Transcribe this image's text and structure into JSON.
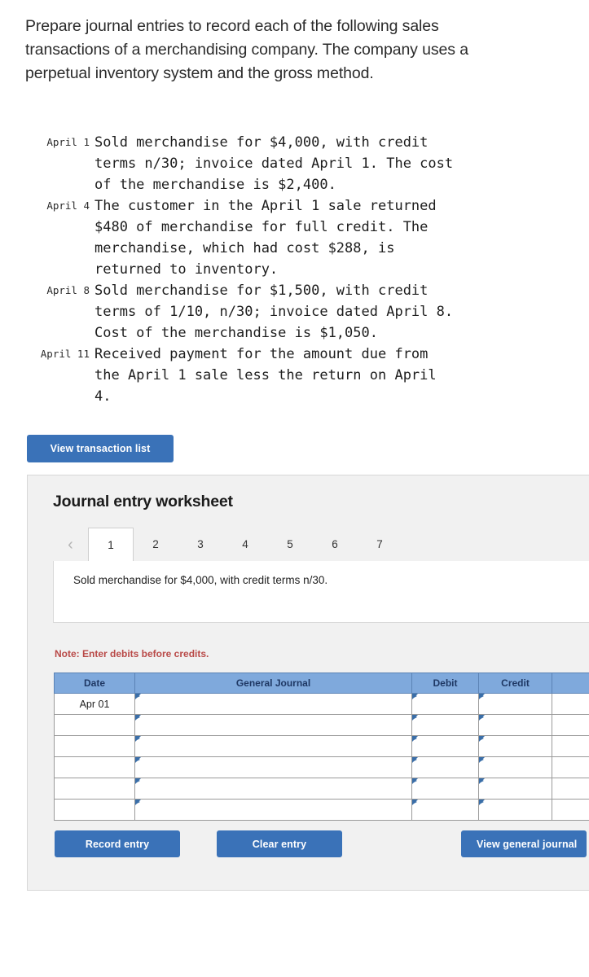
{
  "intro": {
    "text": "Prepare journal entries to record each of the following sales transactions of a merchandising company. The company uses a perpetual inventory system and the gross method."
  },
  "transactions": [
    {
      "date": "April 1",
      "text": "Sold merchandise for $4,000, with credit\nterms n/30; invoice dated April 1. The cost\nof the merchandise is $2,400."
    },
    {
      "date": "April 4",
      "text": "The customer in the April 1 sale returned\n$480 of merchandise for full credit. The\nmerchandise, which had cost $288, is\nreturned to inventory."
    },
    {
      "date": "April 8",
      "text": "Sold merchandise for $1,500, with credit\nterms of 1/10, n/30; invoice dated April 8.\nCost of the merchandise is $1,050."
    },
    {
      "date": "April 11",
      "text": "Received payment for the amount due from\nthe April 1 sale less the return on April\n4."
    }
  ],
  "buttons": {
    "view_transaction_list": "View transaction list",
    "record_entry": "Record entry",
    "clear_entry": "Clear entry",
    "view_general_journal": "View general journal"
  },
  "worksheet": {
    "title": "Journal entry worksheet",
    "prev_icon": "‹",
    "tabs": [
      {
        "label": "1",
        "active": true
      },
      {
        "label": "2",
        "active": false
      },
      {
        "label": "3",
        "active": false
      },
      {
        "label": "4",
        "active": false
      },
      {
        "label": "5",
        "active": false
      },
      {
        "label": "6",
        "active": false
      },
      {
        "label": "7",
        "active": false
      }
    ],
    "description": "Sold merchandise for $4,000, with credit terms n/30.",
    "note": "Note: Enter debits before credits.",
    "table": {
      "headers": [
        "Date",
        "General Journal",
        "Debit",
        "Credit"
      ],
      "rows": [
        {
          "date": "Apr 01",
          "journal": "",
          "debit": "",
          "credit": ""
        },
        {
          "date": "",
          "journal": "",
          "debit": "",
          "credit": ""
        },
        {
          "date": "",
          "journal": "",
          "debit": "",
          "credit": ""
        },
        {
          "date": "",
          "journal": "",
          "debit": "",
          "credit": ""
        },
        {
          "date": "",
          "journal": "",
          "debit": "",
          "credit": ""
        },
        {
          "date": "",
          "journal": "",
          "debit": "",
          "credit": ""
        }
      ]
    }
  },
  "colors": {
    "button_blue": "#3a72b8",
    "header_blue": "#7fa9dc",
    "header_text": "#1f3864",
    "note_red": "#b94a48",
    "panel_bg": "#f1f1f1"
  }
}
